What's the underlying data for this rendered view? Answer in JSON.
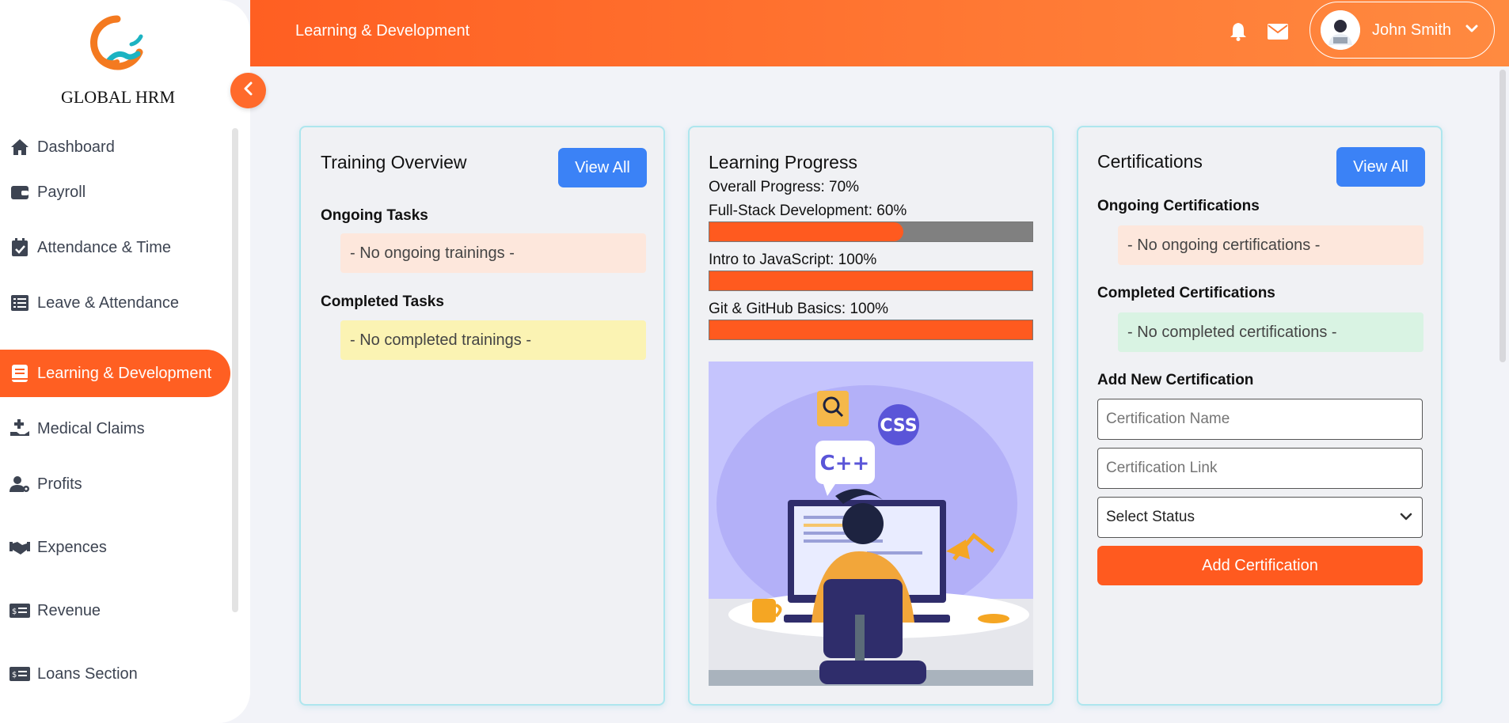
{
  "app": {
    "brand": "GLOBAL HRM"
  },
  "sidebar": {
    "items": [
      {
        "label": "Dashboard",
        "icon": "home-icon"
      },
      {
        "label": "Payroll",
        "icon": "wallet-icon"
      },
      {
        "label": "Attendance & Time",
        "icon": "calendar-check-icon"
      },
      {
        "label": "Leave & Attendance",
        "icon": "list-icon"
      },
      {
        "label": "Learning & Development",
        "icon": "book-icon",
        "active": true
      },
      {
        "label": "Medical Claims",
        "icon": "medical-hand-icon"
      },
      {
        "label": "Profits",
        "icon": "user-gear-icon"
      },
      {
        "label": "Expences",
        "icon": "handshake-icon"
      },
      {
        "label": "Revenue",
        "icon": "money-check-icon"
      },
      {
        "label": "Loans Section",
        "icon": "money-check-icon"
      }
    ]
  },
  "header": {
    "title": "Learning & Development",
    "user_name": "John Smith"
  },
  "training": {
    "title": "Training Overview",
    "view_all": "View All",
    "ongoing_label": "Ongoing Tasks",
    "ongoing_empty": "- No ongoing trainings -",
    "completed_label": "Completed Tasks",
    "completed_empty": "- No completed trainings -"
  },
  "progress": {
    "title": "Learning Progress",
    "overall": "Overall Progress: 70%",
    "courses": [
      {
        "label": "Full-Stack Development: 60%",
        "percent": 60
      },
      {
        "label": "Intro to JavaScript: 100%",
        "percent": 100
      },
      {
        "label": "Git & GitHub Basics: 100%",
        "percent": 100
      }
    ],
    "illustration": {
      "bubble_text_1": "C++",
      "bubble_text_2": "CSS"
    }
  },
  "certifications": {
    "title": "Certifications",
    "view_all": "View All",
    "ongoing_label": "Ongoing Certifications",
    "ongoing_empty": "- No ongoing certifications -",
    "completed_label": "Completed Certifications",
    "completed_empty": "- No completed certifications -",
    "add_label": "Add New Certification",
    "name_placeholder": "Certification Name",
    "link_placeholder": "Certification Link",
    "status_selected": "Select Status",
    "submit": "Add Certification"
  },
  "colors": {
    "accent": "#ff5f22",
    "primary_button": "#3b82f6",
    "card_border": "#aee6ee"
  }
}
